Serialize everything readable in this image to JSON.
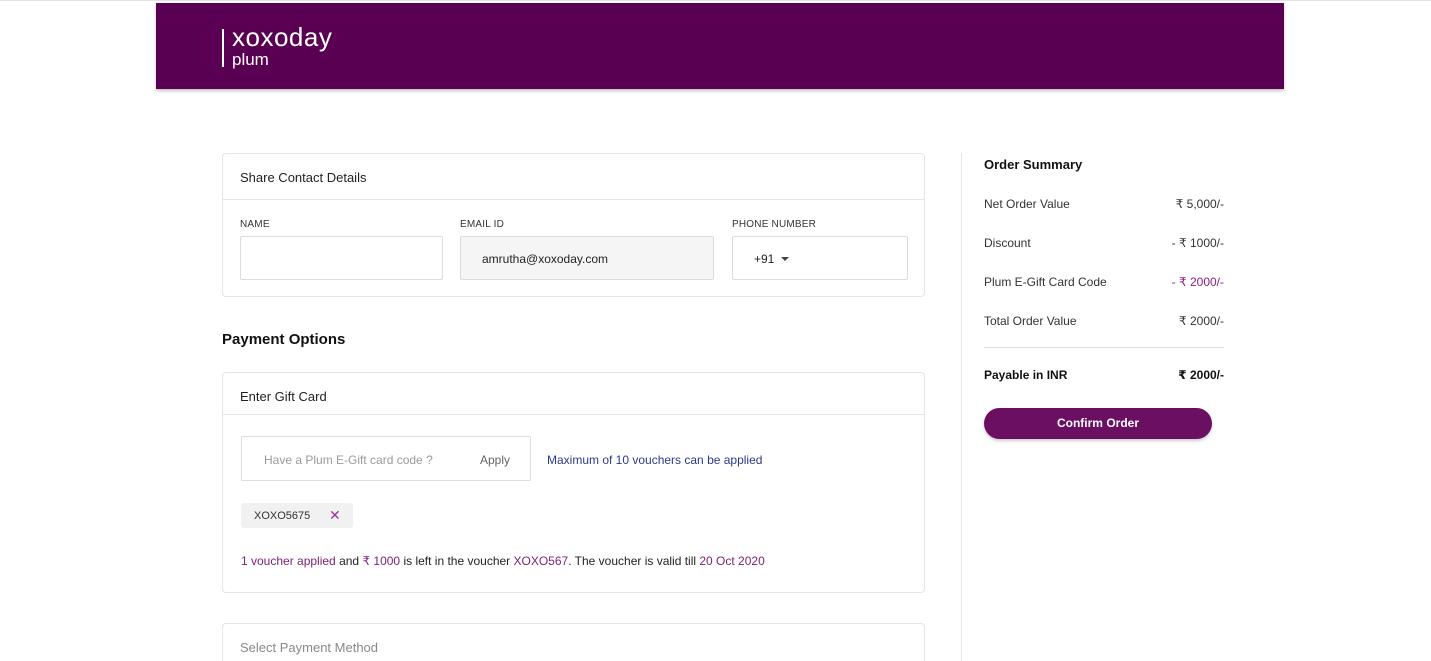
{
  "brand": {
    "logo_top": "xoxoday",
    "logo_bottom": "plum",
    "header_color": "#5a0052",
    "accent": "#6b0f63"
  },
  "contact": {
    "title": "Share Contact Details",
    "name_label": "NAME",
    "name_value": "",
    "email_label": "EMAIL ID",
    "email_value": "amrutha@xoxoday.com",
    "phone_label": "PHONE NUMBER",
    "phone_code": "+91"
  },
  "payment": {
    "heading": "Payment Options",
    "gift_card": {
      "title": "Enter Gift Card",
      "placeholder": "Have a Plum E-Gift card code  ?",
      "apply_label": "Apply",
      "max_note": "Maximum of 10 vouchers can be applied",
      "chip_code": "XOXO5675",
      "chip_close": "✕",
      "applied": {
        "count_text": "1 voucher applied",
        "and": " and ",
        "amount": "₹ 1000",
        "left_text": " is left in the voucher ",
        "voucher": "XOXO567",
        "valid_text": ".  The voucher is valid till ",
        "date": "20 Oct 2020"
      }
    },
    "method_title": "Select Payment Method"
  },
  "summary": {
    "title": "Order Summary",
    "rows": [
      {
        "label": "Net Order Value",
        "value": "₹ 5,000/-"
      },
      {
        "label": "Discount",
        "value": "- ₹ 1000/-"
      },
      {
        "label": "Plum E-Gift Card Code",
        "value": "- ₹ 2000/-"
      },
      {
        "label": "Total Order Value",
        "value": "₹ 2000/-"
      }
    ],
    "payable_label": "Payable in INR",
    "payable_value": "₹ 2000/-",
    "confirm_label": "Confirm Order"
  }
}
